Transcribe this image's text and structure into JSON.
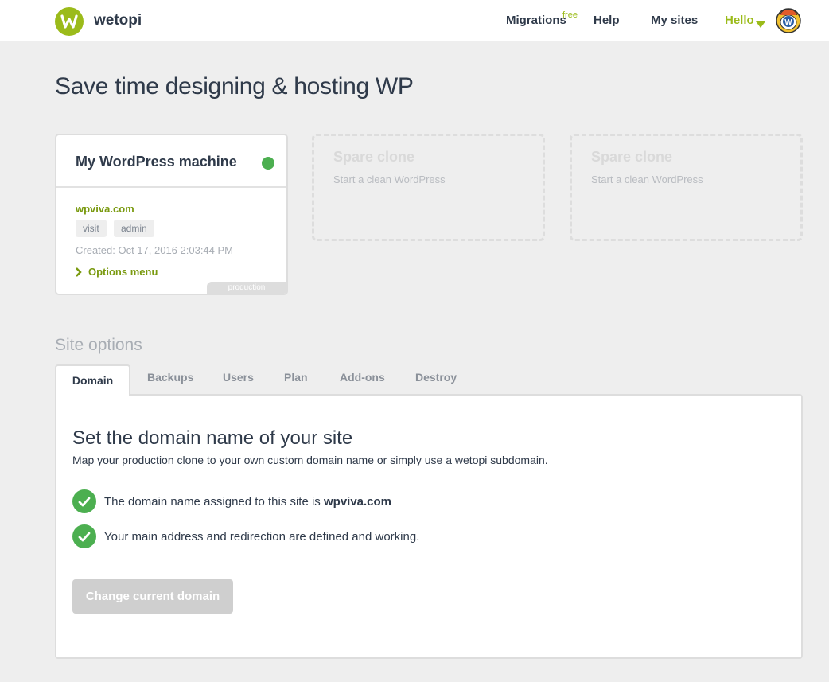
{
  "nav": {
    "brand": "wetopi",
    "migrations": "Migrations",
    "migrations_badge": "free",
    "help": "Help",
    "my_sites": "My sites",
    "hello": "Hello"
  },
  "headline": "Save time designing & hosting WP",
  "machine_card": {
    "title": "My WordPress machine",
    "status_color": "#4caf50",
    "site": "wpviva.com",
    "visit": "visit",
    "admin": "admin",
    "created": "Created: Oct 17, 2016 2:03:44 PM",
    "options_menu": "Options menu",
    "tag": "production"
  },
  "spare_clones": [
    {
      "title": "Spare clone",
      "subtitle": "Start a clean WordPress"
    },
    {
      "title": "Spare clone",
      "subtitle": "Start a clean WordPress"
    }
  ],
  "site_options": {
    "title": "Site options",
    "tabs": [
      "Domain",
      "Backups",
      "Users",
      "Plan",
      "Add-ons",
      "Destroy"
    ],
    "active_tab": "Domain"
  },
  "domain_panel": {
    "title": "Set the domain name of your site",
    "subtitle": "Map your production clone to your own custom domain name or simply use a wetopi subdomain.",
    "check1_text": "The domain name assigned to this site is ",
    "check1_domain": "wpviva.com",
    "check2_text": "Your main address and redirection are defined and working.",
    "button": "Change current domain"
  },
  "colors": {
    "brand_green": "#9bbb1a",
    "status_green": "#4caf50",
    "text_dark": "#2f3a4a"
  }
}
